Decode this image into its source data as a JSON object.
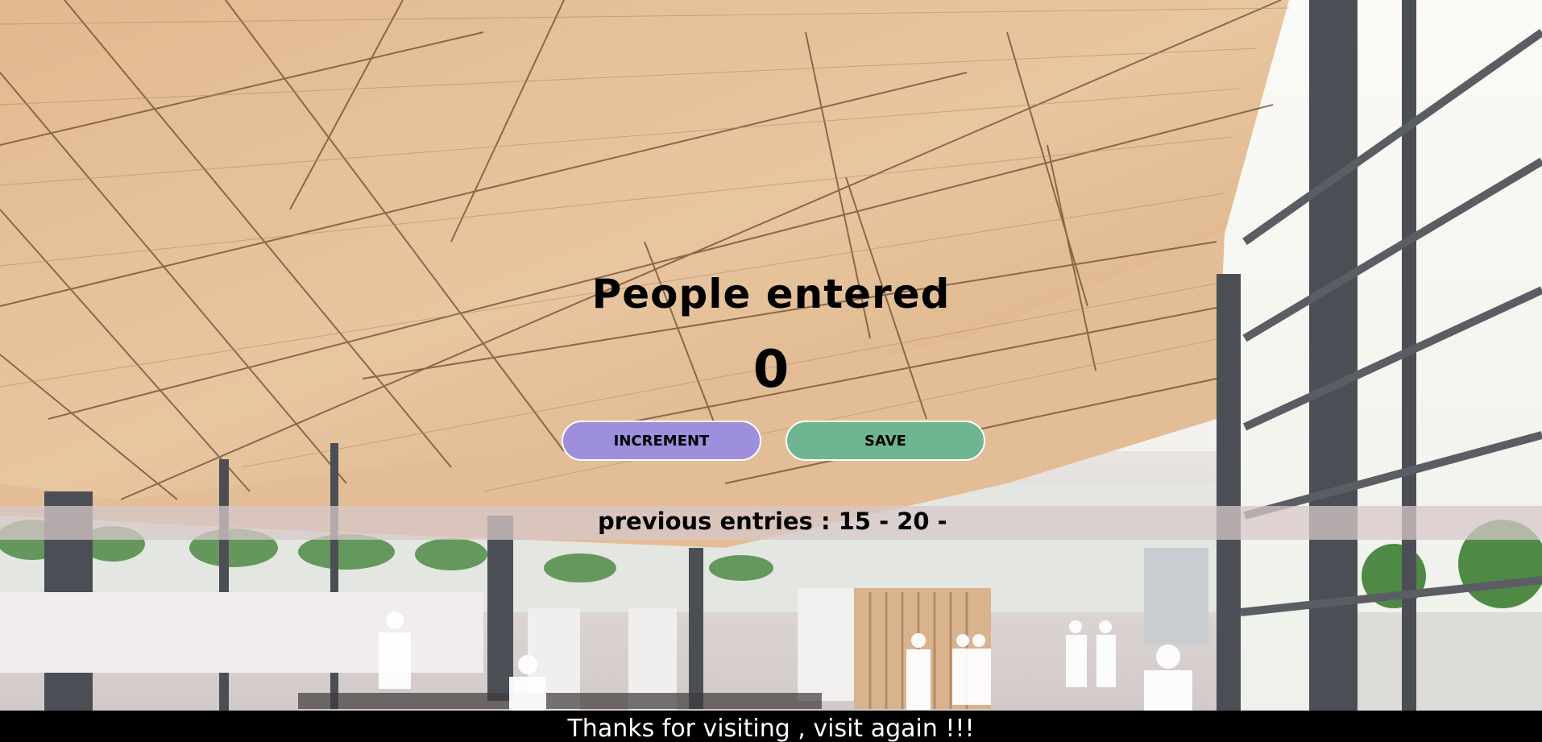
{
  "heading": "People entered",
  "counter": "0",
  "buttons": {
    "increment": "INCREMENT",
    "save": "SAVE"
  },
  "previous_entries": "previous entries : 15 - 20 -",
  "footer": "Thanks for visiting , visit again !!!",
  "colors": {
    "increment_button": "#9d8fdb",
    "save_button": "#6fb592",
    "entries_bar": "#d7c8c8",
    "footer_bg": "#000000"
  },
  "background_image": "building-interior-with-wooden-ceiling"
}
